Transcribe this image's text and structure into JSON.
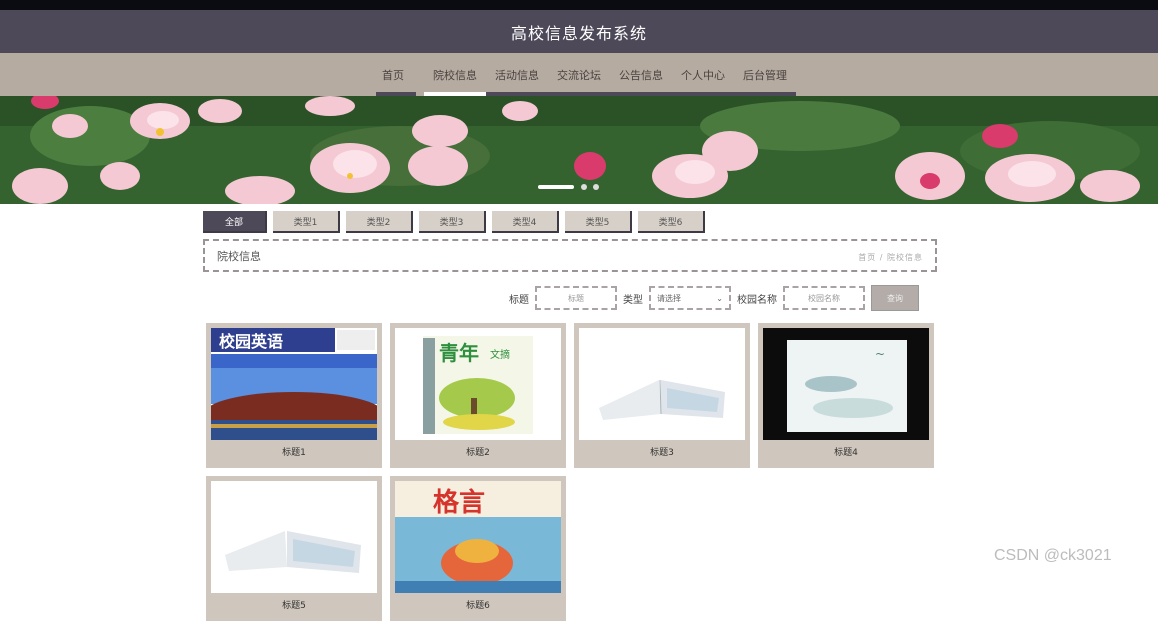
{
  "header": {
    "title": "高校信息发布系统"
  },
  "nav": {
    "items": [
      {
        "label": "首页",
        "active": false
      },
      {
        "label": "院校信息",
        "active": true
      },
      {
        "label": "活动信息",
        "active": false
      },
      {
        "label": "交流论坛",
        "active": false
      },
      {
        "label": "公告信息",
        "active": false
      },
      {
        "label": "个人中心",
        "active": false
      },
      {
        "label": "后台管理",
        "active": false
      }
    ]
  },
  "filters": [
    {
      "label": "全部",
      "active": true
    },
    {
      "label": "类型1"
    },
    {
      "label": "类型2"
    },
    {
      "label": "类型3"
    },
    {
      "label": "类型4"
    },
    {
      "label": "类型5"
    },
    {
      "label": "类型6"
    }
  ],
  "section": {
    "title": "院校信息",
    "crumb": "首页 / 院校信息"
  },
  "search": {
    "title_label": "标题",
    "title_placeholder": "标题",
    "type_label": "类型",
    "type_selected": "请选择",
    "school_label": "校园名称",
    "school_placeholder": "校园名称",
    "button_label": "查询"
  },
  "cards": [
    {
      "caption": "标题1",
      "cover": "magazine-campus-english"
    },
    {
      "caption": "标题2",
      "cover": "magazine-youth-digest"
    },
    {
      "caption": "标题3",
      "cover": "open-book"
    },
    {
      "caption": "标题4",
      "cover": "landscape-book"
    },
    {
      "caption": "标题5",
      "cover": "open-book"
    },
    {
      "caption": "标题6",
      "cover": "magazine-motto"
    }
  ],
  "covers": {
    "campus_english": "校园英语",
    "youth_digest_big": "青年",
    "youth_digest_small": "文摘",
    "motto": "格言"
  },
  "watermark": "CSDN @ck3021",
  "colors": {
    "header": "#4e4959",
    "nav": "#b6aba1",
    "card": "#cfc7bd"
  }
}
